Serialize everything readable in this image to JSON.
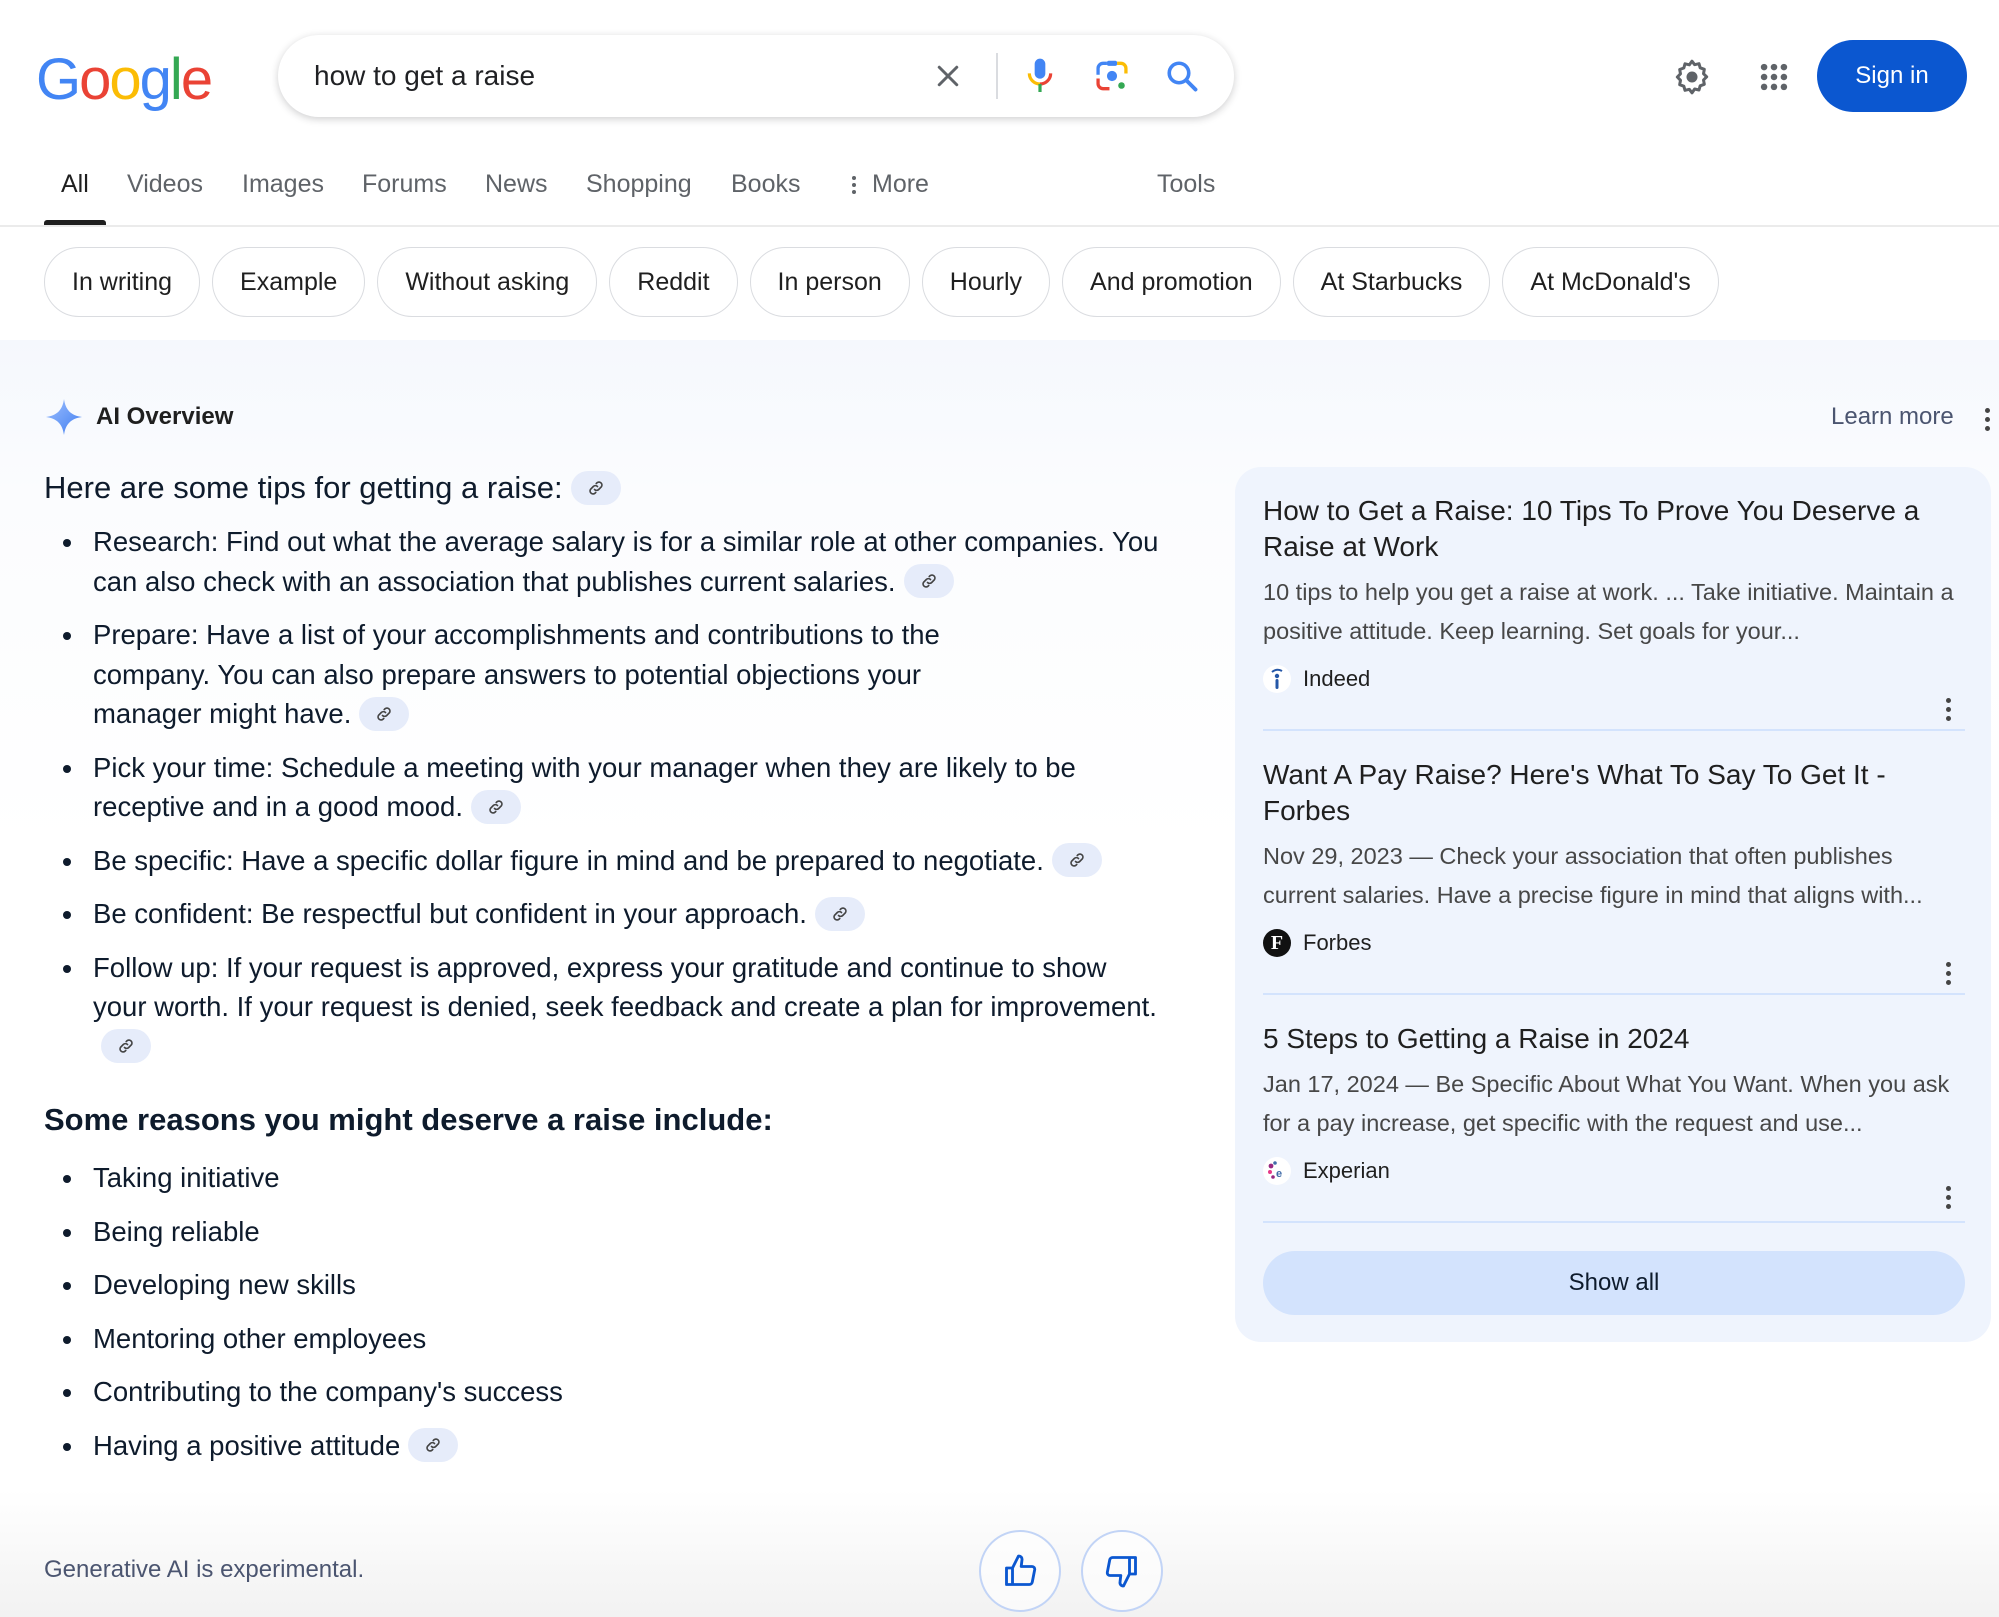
{
  "header": {
    "logo_letters": [
      {
        "ch": "G",
        "color": "#4285f4"
      },
      {
        "ch": "o",
        "color": "#ea4335"
      },
      {
        "ch": "o",
        "color": "#fbbc05"
      },
      {
        "ch": "g",
        "color": "#4285f4"
      },
      {
        "ch": "l",
        "color": "#34a853"
      },
      {
        "ch": "e",
        "color": "#ea4335"
      }
    ],
    "search_query": "how to get a raise",
    "sign_in_label": "Sign in",
    "accent_color": "#0b57d0"
  },
  "tabs": {
    "items": [
      "All",
      "Videos",
      "Images",
      "Forums",
      "News",
      "Shopping",
      "Books"
    ],
    "more_label": "More",
    "tools_label": "Tools",
    "active": "All"
  },
  "chips": [
    "In writing",
    "Example",
    "Without asking",
    "Reddit",
    "In person",
    "Hourly",
    "And promotion",
    "At Starbucks",
    "At McDonald's"
  ],
  "ai_overview": {
    "title": "AI Overview",
    "learn_more": "Learn more",
    "heading": "Here are some tips for getting a raise:",
    "tips": [
      {
        "text": "Research: Find out what the average salary is for a similar role at other companies. You can also check with an association that publishes current salaries."
      },
      {
        "text": "Prepare: Have a list of your accomplishments and contributions to the company. You can also prepare answers to potential objections your manager might have."
      },
      {
        "text": "Pick your time: Schedule a meeting with your manager when they are likely to be receptive and in a good mood."
      },
      {
        "text": "Be specific: Have a specific dollar figure in mind and be prepared to negotiate."
      },
      {
        "text": "Be confident: Be respectful but confident in your approach."
      },
      {
        "text": "Follow up: If your request is approved, express your gratitude and continue to show your worth. If your request is denied, seek feedback and create a plan for improvement."
      }
    ],
    "reasons_heading": "Some reasons you might deserve a raise include:",
    "reasons": [
      "Taking initiative",
      "Being reliable",
      "Developing new skills",
      "Mentoring other employees",
      "Contributing to the company's success",
      "Having a positive attitude"
    ],
    "disclaimer": "Generative AI is experimental."
  },
  "sources": {
    "items": [
      {
        "title": "How to Get a Raise: 10 Tips To Prove You Deserve a Raise at Work",
        "snippet": "10 tips to help you get a raise at work. ... Take initiative. Maintain a positive attitude. Keep learning. Set goals for your...",
        "site": "Indeed",
        "favicon": "i"
      },
      {
        "title": "Want A Pay Raise? Here's What To Say To Get It - Forbes",
        "snippet": "Nov 29, 2023 — Check your association that often publishes current salaries. Have a precise figure in mind that aligns with...",
        "site": "Forbes",
        "favicon": "F"
      },
      {
        "title": "5 Steps to Getting a Raise in 2024",
        "snippet": "Jan 17, 2024 — Be Specific About What You Want. When you ask for a pay increase, get specific with the request and use...",
        "site": "Experian",
        "favicon": "e"
      }
    ],
    "show_all_label": "Show all"
  }
}
